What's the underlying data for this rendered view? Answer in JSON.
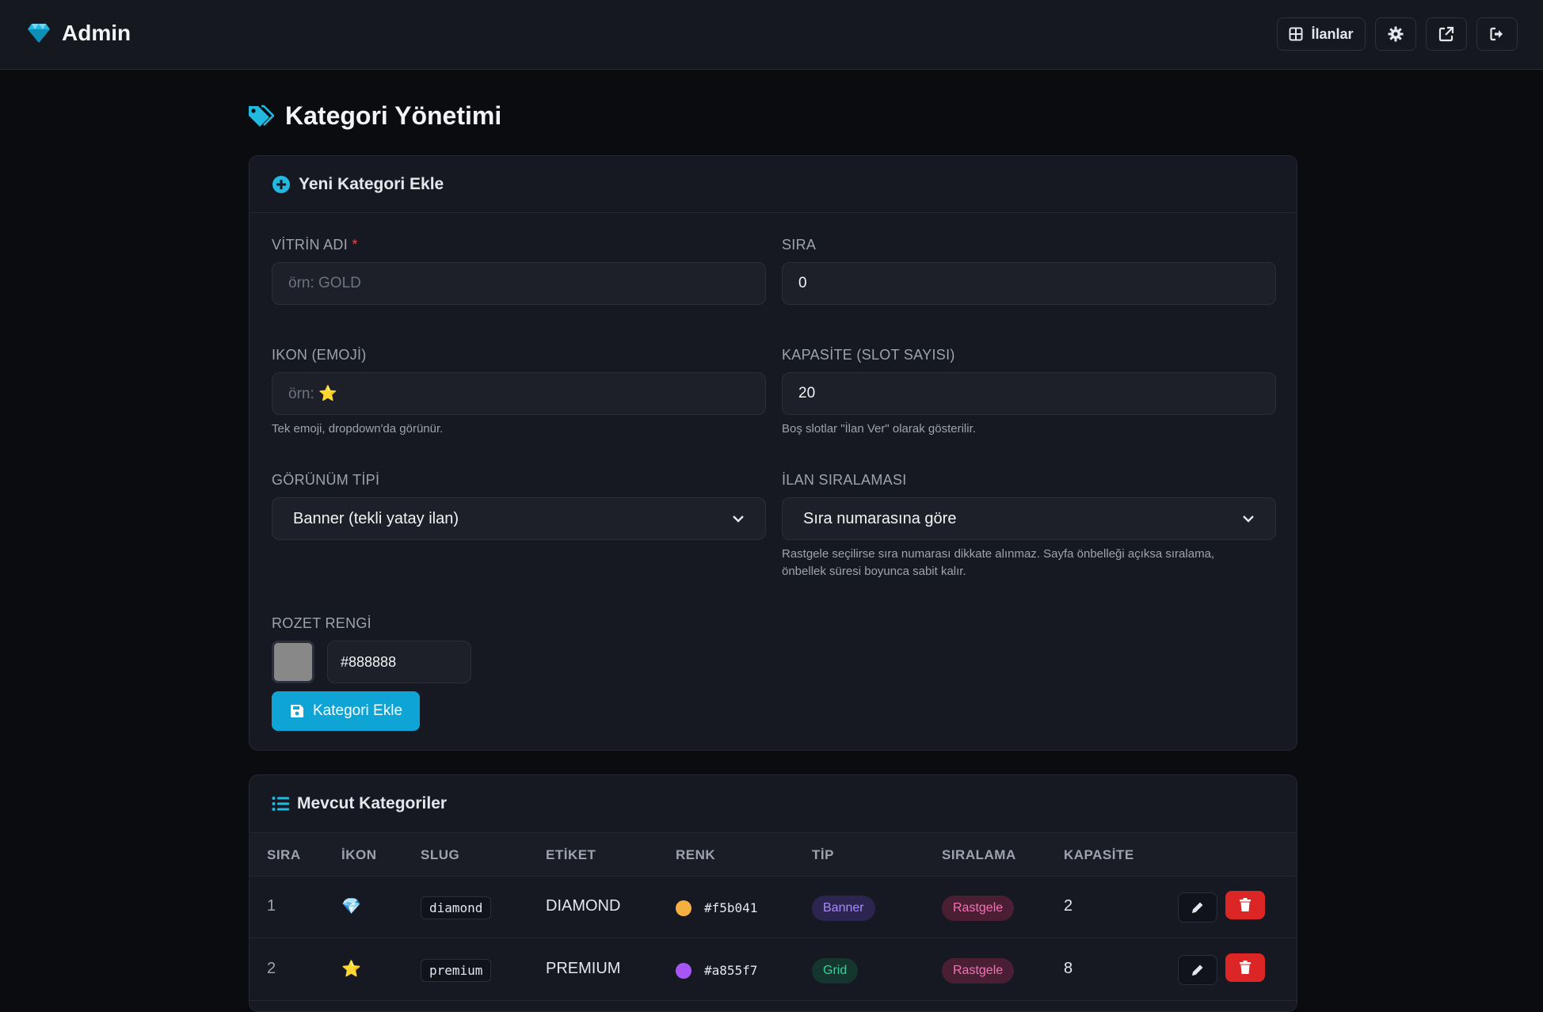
{
  "topbar": {
    "brand": "Admin",
    "ilanlar_label": "İlanlar"
  },
  "page": {
    "title": "Kategori Yönetimi"
  },
  "form": {
    "header": "Yeni Kategori Ekle",
    "vitrin_label": "VİTRİN ADI",
    "vitrin_required": "*",
    "vitrin_placeholder": "örn: GOLD",
    "sira_label": "SIRA",
    "sira_value": "0",
    "ikon_label": "IKON (EMOJİ)",
    "ikon_placeholder": "örn: ⭐",
    "ikon_hint": "Tek emoji, dropdown'da görünür.",
    "kapasite_label": "KAPASİTE (SLOT SAYISI)",
    "kapasite_value": "20",
    "kapasite_hint": "Boş slotlar \"İlan Ver\" olarak gösterilir.",
    "gorunum_label": "GÖRÜNÜM TİPİ",
    "gorunum_value": "Banner (tekli yatay ilan)",
    "siralama_label": "İLAN SIRALAMASI",
    "siralama_value": "Sıra numarasına göre",
    "siralama_hint_1": "Rastgele seçilirse sıra numarası dikkate alınmaz. Sayfa önbelleği açıksa sıralama,",
    "siralama_hint_2": "önbellek süresi boyunca sabit kalır.",
    "rozet_label": "ROZET RENGİ",
    "rozet_value": "#888888",
    "rozet_color": "#888888",
    "submit_label": "Kategori Ekle"
  },
  "table": {
    "header": "Mevcut Kategoriler",
    "columns": [
      "SIRA",
      "İKON",
      "SLUG",
      "ETİKET",
      "RENK",
      "TİP",
      "SIRALAMA",
      "KAPASİTE"
    ],
    "rows": [
      {
        "sira": "1",
        "ikon": "💎",
        "slug": "diamond",
        "etiket": "DIAMOND",
        "renk": "#f5b041",
        "tip": "Banner",
        "siralama": "Rastgele",
        "kapasite": "2"
      },
      {
        "sira": "2",
        "ikon": "⭐",
        "slug": "premium",
        "etiket": "PREMIUM",
        "renk": "#a855f7",
        "tip": "Grid",
        "siralama": "Rastgele",
        "kapasite": "8"
      }
    ]
  },
  "colors": {
    "accent": "#0ea5d6",
    "danger": "#dc2626"
  }
}
